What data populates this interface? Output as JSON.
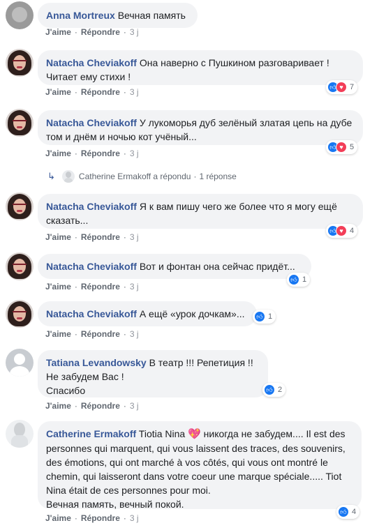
{
  "labels": {
    "like": "J'aime",
    "reply": "Répondre",
    "separator": "·"
  },
  "colors": {
    "author": "#385898",
    "bubble": "#f2f3f5",
    "like": "#1877f2",
    "love": "#f33e58"
  },
  "icons": {
    "like": "thumbs-up-icon",
    "love": "heart-icon",
    "reply_arrow": "reply-arrow-icon"
  },
  "comments": [
    {
      "author": "Anna Mortreux",
      "text": "Вечная память",
      "time": "3 j"
    },
    {
      "author": "Natacha Cheviakoff",
      "text": "Она наверно с Пушкином разговаривает ! Читает ему стихи !",
      "time": "3 j",
      "reactions": "7"
    },
    {
      "author": "Natacha Cheviakoff",
      "text": "У лукоморья дуб зелёный златая цепь на дубе том и днём и ночью кот учёный...",
      "time": "3 j",
      "reactions": "5"
    },
    {
      "author": "Natacha Cheviakoff",
      "text": "Я к вам пишу чего же более что я могу ещё сказать...",
      "time": "3 j",
      "reactions": "4"
    },
    {
      "author": "Natacha Cheviakoff",
      "text": "Вот и фонтан она сейчас придёт...",
      "time": "3 j",
      "reactions": "1"
    },
    {
      "author": "Natacha Cheviakoff",
      "text": "А ещё «урок дочкам»...",
      "time": "3 j",
      "reactions": "1"
    },
    {
      "author": "Tatiana Levandowsky",
      "text_lines": [
        "В театр !!! Репетиция !!",
        "Не забудем Вас !",
        "Спасибо"
      ],
      "time": "3 j",
      "reactions": "2"
    },
    {
      "author": "Catherine Ermakoff",
      "text_before_emoji": "Tiotia Nina",
      "emoji": "💖",
      "text_after_emoji": "никогда не забудем.... Il est des personnes qui marquent, qui vous laissent des traces, des souvenirs, des émotions, qui ont marché à vos côtés, qui vous ont montré le chemin, qui laisseront dans votre coeur une marque spéciale..... Tiot Nina était de ces personnes pour moi.",
      "text_last_line": "Вечная память, вечный покой.",
      "time": "3 j",
      "reactions": "4"
    }
  ],
  "reply_thread": {
    "author_text": "Catherine Ermakoff a répondu",
    "count_text": "1 réponse"
  }
}
